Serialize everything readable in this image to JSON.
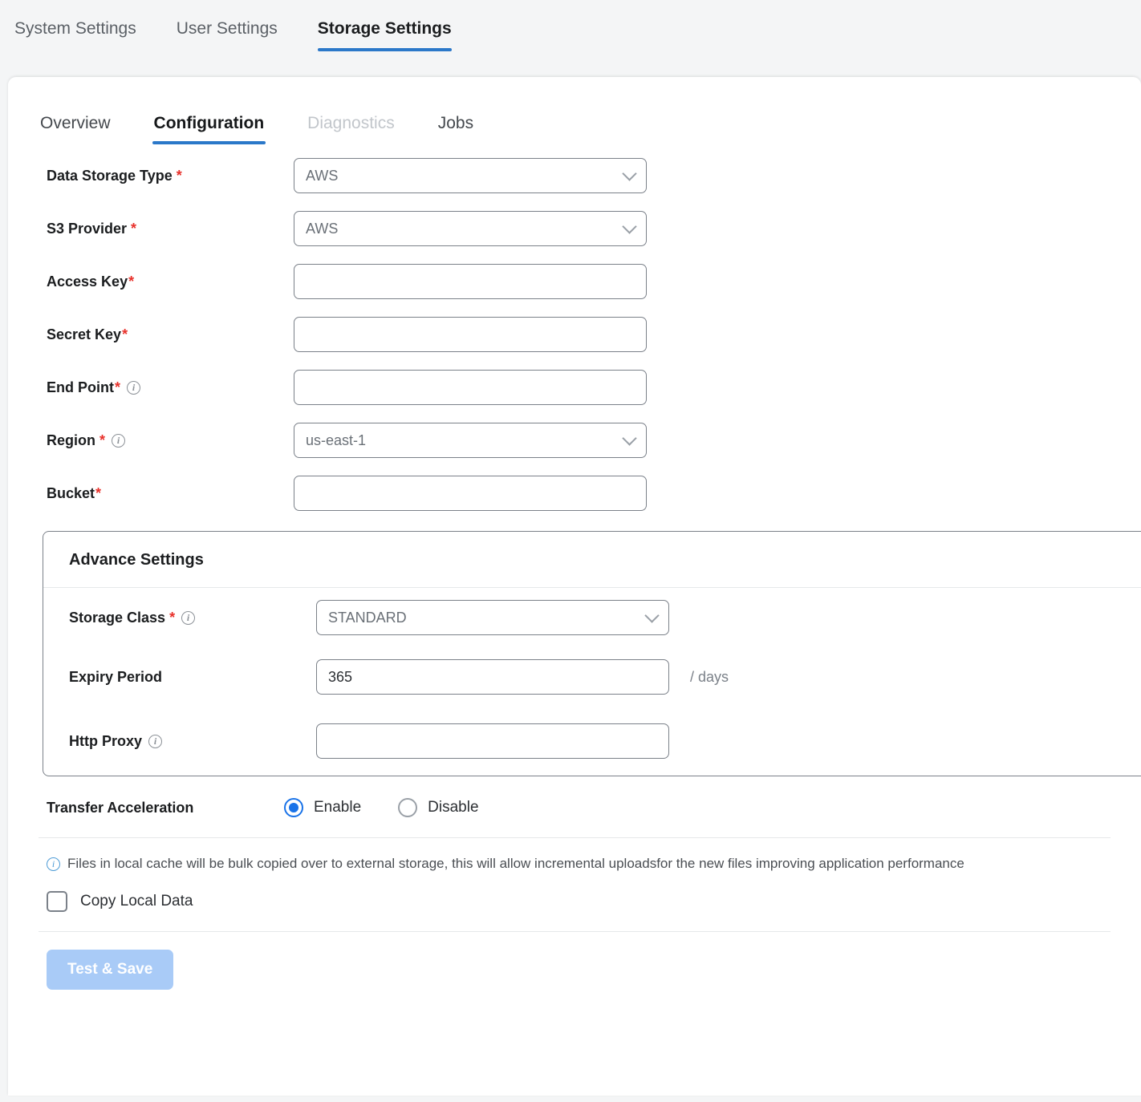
{
  "top_tabs": [
    {
      "label": "System Settings",
      "active": false
    },
    {
      "label": "User Settings",
      "active": false
    },
    {
      "label": "Storage Settings",
      "active": true
    }
  ],
  "sub_tabs": [
    {
      "label": "Overview",
      "state": "normal"
    },
    {
      "label": "Configuration",
      "state": "active"
    },
    {
      "label": "Diagnostics",
      "state": "disabled"
    },
    {
      "label": "Jobs",
      "state": "normal"
    }
  ],
  "form": {
    "data_storage_type": {
      "label": "Data Storage Type",
      "required": "*",
      "value": "AWS",
      "icon": "chevron-down-icon"
    },
    "s3_provider": {
      "label": "S3 Provider",
      "required": "*",
      "value": "AWS",
      "icon": "chevron-down-icon"
    },
    "access_key": {
      "label": "Access Key",
      "required": "*",
      "value": "",
      "placeholder": ""
    },
    "secret_key": {
      "label": "Secret Key",
      "required": "*",
      "value": "",
      "placeholder": ""
    },
    "end_point": {
      "label": "End Point",
      "required": "*",
      "value": "",
      "placeholder": "",
      "info": "info-icon"
    },
    "region": {
      "label": "Region",
      "required": "*",
      "value": "us-east-1",
      "info": "info-icon",
      "icon": "chevron-down-icon"
    },
    "bucket": {
      "label": "Bucket",
      "required": "*",
      "value": "",
      "placeholder": ""
    }
  },
  "advance": {
    "title": "Advance Settings",
    "storage_class": {
      "label": "Storage Class",
      "required": "*",
      "value": "STANDARD",
      "info": "info-icon",
      "icon": "chevron-down-icon"
    },
    "expiry_period": {
      "label": "Expiry Period",
      "value": "365",
      "suffix": "/ days"
    },
    "http_proxy": {
      "label": "Http Proxy",
      "value": "",
      "placeholder": "",
      "info": "info-icon"
    }
  },
  "transfer_acceleration": {
    "label": "Transfer Acceleration",
    "options": [
      {
        "label": "Enable",
        "selected": true
      },
      {
        "label": "Disable",
        "selected": false
      }
    ]
  },
  "notice": {
    "icon": "info-icon",
    "text": "Files in local cache will be bulk copied over to external storage, this will allow incremental uploadsfor the new files improving application performance"
  },
  "copy_local_data": {
    "label": "Copy Local Data",
    "checked": false
  },
  "actions": {
    "test_and_save": "Test & Save"
  },
  "colors": {
    "accent": "#2b78c9",
    "radio_selected": "#1a73e8",
    "required_asterisk": "#e8302a",
    "button_disabled": "#a9cbf7",
    "info_blue": "#4c9bd6"
  }
}
